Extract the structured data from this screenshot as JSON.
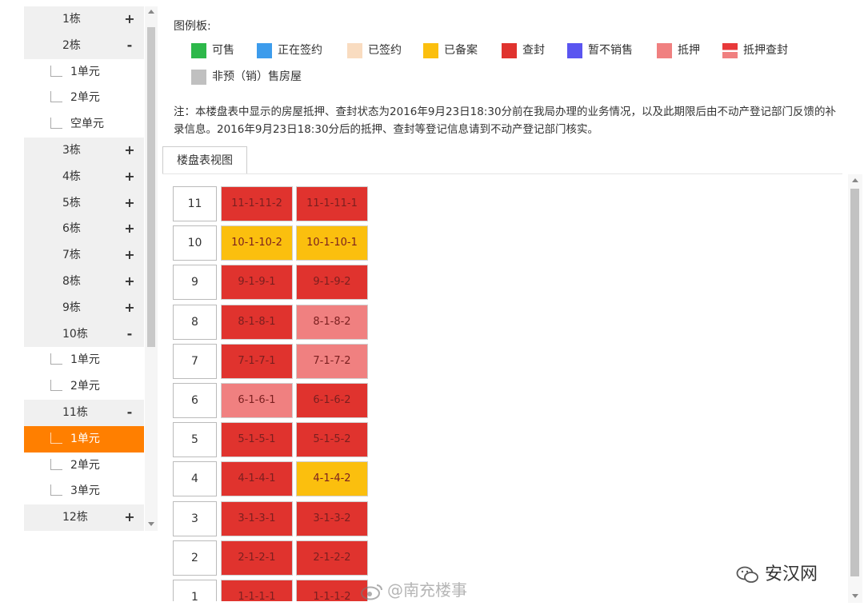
{
  "tree": {
    "nodes": [
      {
        "type": "building",
        "label": "1栋",
        "toggle": "+"
      },
      {
        "type": "building",
        "label": "2栋",
        "toggle": "-"
      },
      {
        "type": "unit",
        "label": "1单元"
      },
      {
        "type": "unit",
        "label": "2单元"
      },
      {
        "type": "unit",
        "label": "空单元"
      },
      {
        "type": "building",
        "label": "3栋",
        "toggle": "+"
      },
      {
        "type": "building",
        "label": "4栋",
        "toggle": "+"
      },
      {
        "type": "building",
        "label": "5栋",
        "toggle": "+"
      },
      {
        "type": "building",
        "label": "6栋",
        "toggle": "+"
      },
      {
        "type": "building",
        "label": "7栋",
        "toggle": "+"
      },
      {
        "type": "building",
        "label": "8栋",
        "toggle": "+"
      },
      {
        "type": "building",
        "label": "9栋",
        "toggle": "+"
      },
      {
        "type": "building",
        "label": "10栋",
        "toggle": "-"
      },
      {
        "type": "unit",
        "label": "1单元"
      },
      {
        "type": "unit",
        "label": "2单元"
      },
      {
        "type": "building",
        "label": "11栋",
        "toggle": "-"
      },
      {
        "type": "unit",
        "label": "1单元",
        "active": true
      },
      {
        "type": "unit",
        "label": "2单元"
      },
      {
        "type": "unit",
        "label": "3单元"
      },
      {
        "type": "building",
        "label": "12栋",
        "toggle": "+"
      }
    ]
  },
  "legend": {
    "title": "图例板:",
    "items": [
      {
        "label": "可售",
        "color": "#2db84a"
      },
      {
        "label": "正在签约",
        "color": "#3d9cec"
      },
      {
        "label": "已签约",
        "color": "#f9dcc0"
      },
      {
        "label": "已备案",
        "color": "#fbbf0e"
      },
      {
        "label": "查封",
        "color": "#e0332e"
      },
      {
        "label": "暂不销售",
        "color": "#5a55f0"
      },
      {
        "label": "抵押",
        "color": "#f08080"
      },
      {
        "label": "抵押查封",
        "color": "#e8393a"
      },
      {
        "label": "非预（销）售房屋",
        "color": "#c0c0c0"
      }
    ]
  },
  "note": "注：本楼盘表中显示的房屋抵押、查封状态为2016年9月23日18:30分前在我局办理的业务情况，以及此期限后由不动产登记部门反馈的补录信息。2016年9月23日18:30分后的抵押、查封等登记信息请到不动产登记部门核实。",
  "tab": {
    "label": "楼盘表视图"
  },
  "floors": [
    {
      "floor": "11",
      "rooms": [
        {
          "label": "11-1-11-2",
          "status": "查封"
        },
        {
          "label": "11-1-11-1",
          "status": "查封"
        }
      ]
    },
    {
      "floor": "10",
      "rooms": [
        {
          "label": "10-1-10-2",
          "status": "已备案"
        },
        {
          "label": "10-1-10-1",
          "status": "已备案"
        }
      ]
    },
    {
      "floor": "9",
      "rooms": [
        {
          "label": "9-1-9-1",
          "status": "查封"
        },
        {
          "label": "9-1-9-2",
          "status": "查封"
        }
      ]
    },
    {
      "floor": "8",
      "rooms": [
        {
          "label": "8-1-8-1",
          "status": "查封"
        },
        {
          "label": "8-1-8-2",
          "status": "抵押"
        }
      ]
    },
    {
      "floor": "7",
      "rooms": [
        {
          "label": "7-1-7-1",
          "status": "查封"
        },
        {
          "label": "7-1-7-2",
          "status": "抵押"
        }
      ]
    },
    {
      "floor": "6",
      "rooms": [
        {
          "label": "6-1-6-1",
          "status": "抵押"
        },
        {
          "label": "6-1-6-2",
          "status": "查封"
        }
      ]
    },
    {
      "floor": "5",
      "rooms": [
        {
          "label": "5-1-5-1",
          "status": "查封"
        },
        {
          "label": "5-1-5-2",
          "status": "查封"
        }
      ]
    },
    {
      "floor": "4",
      "rooms": [
        {
          "label": "4-1-4-1",
          "status": "查封"
        },
        {
          "label": "4-1-4-2",
          "status": "已备案"
        }
      ]
    },
    {
      "floor": "3",
      "rooms": [
        {
          "label": "3-1-3-1",
          "status": "查封"
        },
        {
          "label": "3-1-3-2",
          "status": "查封"
        }
      ]
    },
    {
      "floor": "2",
      "rooms": [
        {
          "label": "2-1-2-1",
          "status": "查封"
        },
        {
          "label": "2-1-2-2",
          "status": "查封"
        }
      ]
    },
    {
      "floor": "1",
      "rooms": [
        {
          "label": "1-1-1-1",
          "status": "查封"
        },
        {
          "label": "1-1-1-2",
          "status": "查封"
        }
      ]
    }
  ],
  "watermarks": {
    "weibo": "@南充楼事",
    "brand": "安汉网"
  }
}
